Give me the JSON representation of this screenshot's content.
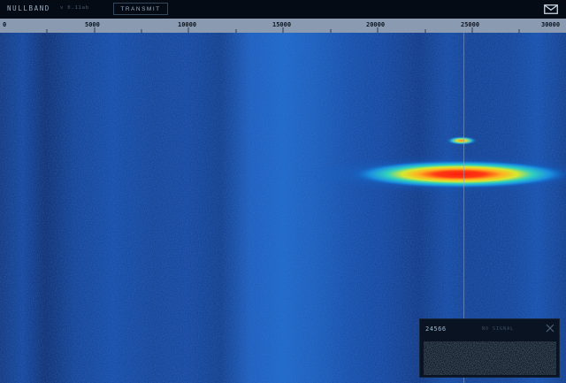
{
  "header": {
    "brand": "NULLBAND",
    "subtitle": "v 0.11ab",
    "transmit_label": "TRANSMIT",
    "mail_icon": "mail-icon"
  },
  "ruler": {
    "labels": [
      "0",
      "5000",
      "10000",
      "15000",
      "20000",
      "25000",
      "30000"
    ]
  },
  "popup": {
    "frequency": "24566",
    "status": "NO SIGNAL",
    "close_icon": "close-icon"
  },
  "colors": {
    "background": "#040a14",
    "ruler": "#8a9ab0",
    "waterfall_base": "#0b3a96",
    "signal_hot": "#ff2a10"
  }
}
